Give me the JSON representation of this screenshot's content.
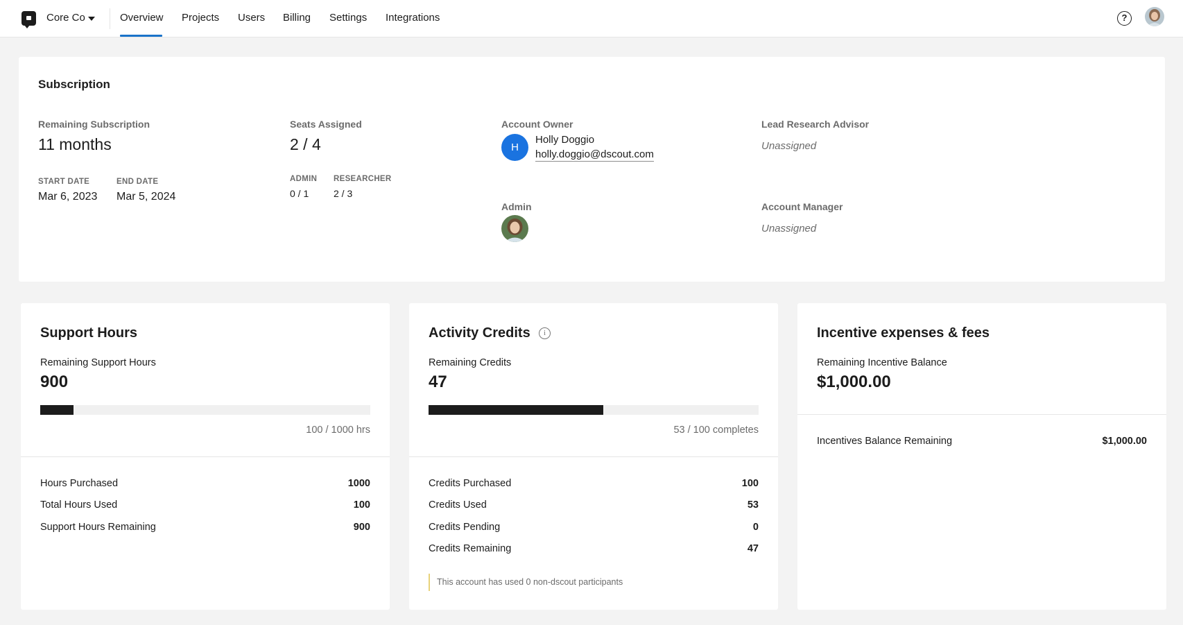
{
  "header": {
    "org_name": "Core Co",
    "nav": [
      "Overview",
      "Projects",
      "Users",
      "Billing",
      "Settings",
      "Integrations"
    ],
    "active_tab": "Overview"
  },
  "subscription": {
    "title": "Subscription",
    "remaining_label": "Remaining Subscription",
    "remaining_value": "11 months",
    "start_label": "START DATE",
    "start_value": "Mar 6, 2023",
    "end_label": "END DATE",
    "end_value": "Mar 5, 2024",
    "seats_label": "Seats Assigned",
    "seats_value": "2 / 4",
    "admin_label": "ADMIN",
    "admin_value": "0 / 1",
    "researcher_label": "RESEARCHER",
    "researcher_value": "2 / 3",
    "owner_label": "Account Owner",
    "owner_initial": "H",
    "owner_name": "Holly Doggio",
    "owner_email": "holly.doggio@dscout.com",
    "admin_section_label": "Admin",
    "lead_label": "Lead Research Advisor",
    "lead_value": "Unassigned",
    "manager_label": "Account Manager",
    "manager_value": "Unassigned"
  },
  "support": {
    "title": "Support Hours",
    "remaining_label": "Remaining Support Hours",
    "remaining_value": "900",
    "progress_fraction": 0.1,
    "caption": "100 / 1000 hrs",
    "rows": [
      {
        "label": "Hours Purchased",
        "value": "1000"
      },
      {
        "label": "Total Hours Used",
        "value": "100"
      },
      {
        "label": "Support Hours Remaining",
        "value": "900"
      }
    ]
  },
  "credits": {
    "title": "Activity Credits",
    "remaining_label": "Remaining Credits",
    "remaining_value": "47",
    "progress_fraction": 0.53,
    "caption": "53 / 100 completes",
    "rows": [
      {
        "label": "Credits Purchased",
        "value": "100"
      },
      {
        "label": "Credits Used",
        "value": "53"
      },
      {
        "label": "Credits Pending",
        "value": "0"
      },
      {
        "label": "Credits Remaining",
        "value": "47"
      }
    ],
    "note": "This account has used 0 non-dscout participants"
  },
  "incentives": {
    "title": "Incentive expenses & fees",
    "remaining_label": "Remaining Incentive Balance",
    "remaining_value": "$1,000.00",
    "rows": [
      {
        "label": "Incentives Balance Remaining",
        "value": "$1,000.00"
      }
    ]
  },
  "colors": {
    "accent": "#1a73c9",
    "avatar_blue": "#1a73e0",
    "bar_fill": "#1c1c1c",
    "note_border": "#e8d27a"
  }
}
